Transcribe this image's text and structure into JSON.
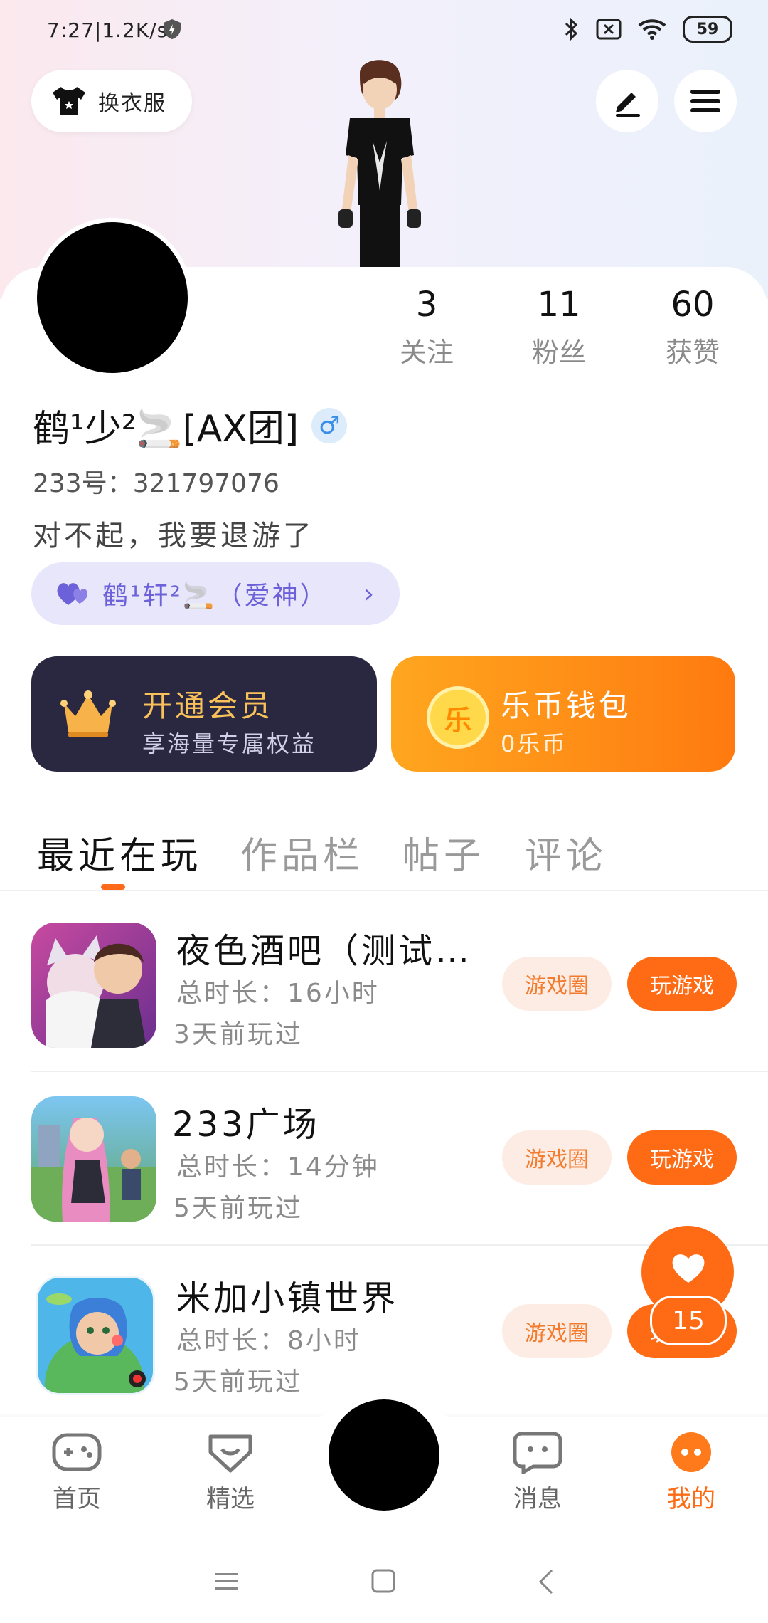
{
  "status_bar": {
    "time": "7:27",
    "speed": "1.2K/s",
    "battery": "59"
  },
  "header": {
    "dress_label": "换衣服"
  },
  "profile": {
    "stats": [
      {
        "value": "3",
        "label": "关注"
      },
      {
        "value": "11",
        "label": "粉丝"
      },
      {
        "value": "60",
        "label": "获赞"
      }
    ],
    "name": "鹤¹少²🚬[AX团]",
    "gender_symbol": "♂",
    "id_text": "233号：321797076",
    "bio": "对不起，我要退游了",
    "lover": "鹤¹轩²🚬（爱神）"
  },
  "cards": {
    "vip_title": "开通会员",
    "vip_sub": "享海量专属权益",
    "wallet_title": "乐币钱包",
    "wallet_sub": "0乐币",
    "coin_char": "乐"
  },
  "tabs": [
    {
      "label": "最近在玩"
    },
    {
      "label": "作品栏"
    },
    {
      "label": "帖子"
    },
    {
      "label": "评论"
    }
  ],
  "games": [
    {
      "title": "夜色酒吧（测试…",
      "duration": "总时长：16小时",
      "last": "3天前玩过",
      "circle_btn": "游戏圈",
      "play_btn": "玩游戏"
    },
    {
      "title": "233广场",
      "duration": "总时长：14分钟",
      "last": "5天前玩过",
      "circle_btn": "游戏圈",
      "play_btn": "玩游戏"
    },
    {
      "title": "米加小镇世界",
      "duration": "总时长：8小时",
      "last": "5天前玩过",
      "circle_btn": "游戏圈",
      "play_btn": "玩游戏"
    }
  ],
  "fab": {
    "count": "15"
  },
  "bottom_nav": [
    {
      "label": "首页"
    },
    {
      "label": "精选"
    },
    {
      "label": "消息"
    },
    {
      "label": "我的"
    }
  ],
  "colors": {
    "accent": "#ff6b14",
    "lover_bg": "#e7e6fb",
    "vip_bg": "#2a2840"
  }
}
